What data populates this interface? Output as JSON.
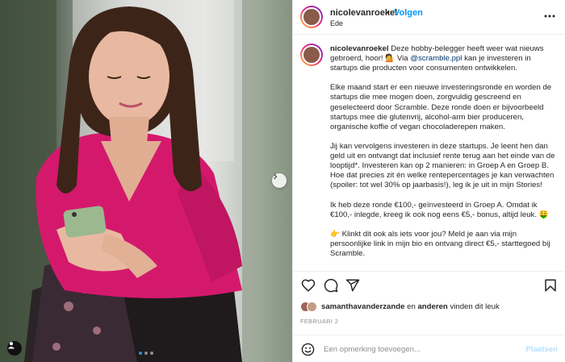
{
  "post": {
    "username": "nicolevanroekel",
    "separator": "•",
    "follow_label": "Volgen",
    "location": "Ede",
    "caption": {
      "author": "nicolevanroekel",
      "line1_a": " Deze hobby-belegger heeft weer wat nieuws gebroerd, hoor! ",
      "line1_emoji": "💁",
      "line1_b": " Via ",
      "mention": "@scramble.ppl",
      "line1_c": " kan je investeren in startups die producten voor consumenten ontwikkelen.",
      "p2": "Elke maand start er een nieuwe investeringsronde en worden de startups die mee mogen doen, zorgvuldig gescreend en geselecteerd door Scramble. Deze ronde doen er bijvoorbeeld startups mee die glutenvrij, alcohol-arm bier produceren, organische koffie of vegan chocoladerepen maken.",
      "p3": "Jij kan vervolgens investeren in deze startups. Je leent hen dan geld uit en ontvangt dat inclusief rente terug aan het einde van de looptijd*. Investeren kan op 2 manieren: in Groep A en Groep B. Hoe dat precies zit én welke rentepercentages je kan verwachten (spoiler: tot wel 30% op jaarbasis!), leg ik je uit in mijn Stories!",
      "p4": "Ik heb deze ronde €100,- geïnvesteerd in Groep A. Omdat ik €100,- inlegde, kreeg ik ook nog eens €5,- bonus, altijd leuk. 🤑",
      "p5": "👉 Klinkt dit ook als iets voor jou? Meld je aan via mijn persoonlijke link in mijn bio en ontvang direct €5,- starttegoed bij Scramble."
    },
    "likes": {
      "user": "samanthavanderzande",
      "connector": " en ",
      "others": "anderen",
      "suffix": " vinden dit leuk"
    },
    "date": "FEBRUARI 2",
    "comment": {
      "placeholder": "Een opmerking toevoegen...",
      "post_label": "Plaatsen"
    },
    "carousel": {
      "current_index": 1,
      "count": 3
    }
  },
  "colors": {
    "follow": "#0095f6",
    "mention": "#00376b",
    "sweater": "#d4196d",
    "muted": "#8e8e8e"
  },
  "icons": [
    "more-options-icon",
    "heart-icon",
    "comment-icon",
    "share-icon",
    "bookmark-icon",
    "emoji-icon",
    "chevron-right-icon",
    "user-tag-icon"
  ]
}
